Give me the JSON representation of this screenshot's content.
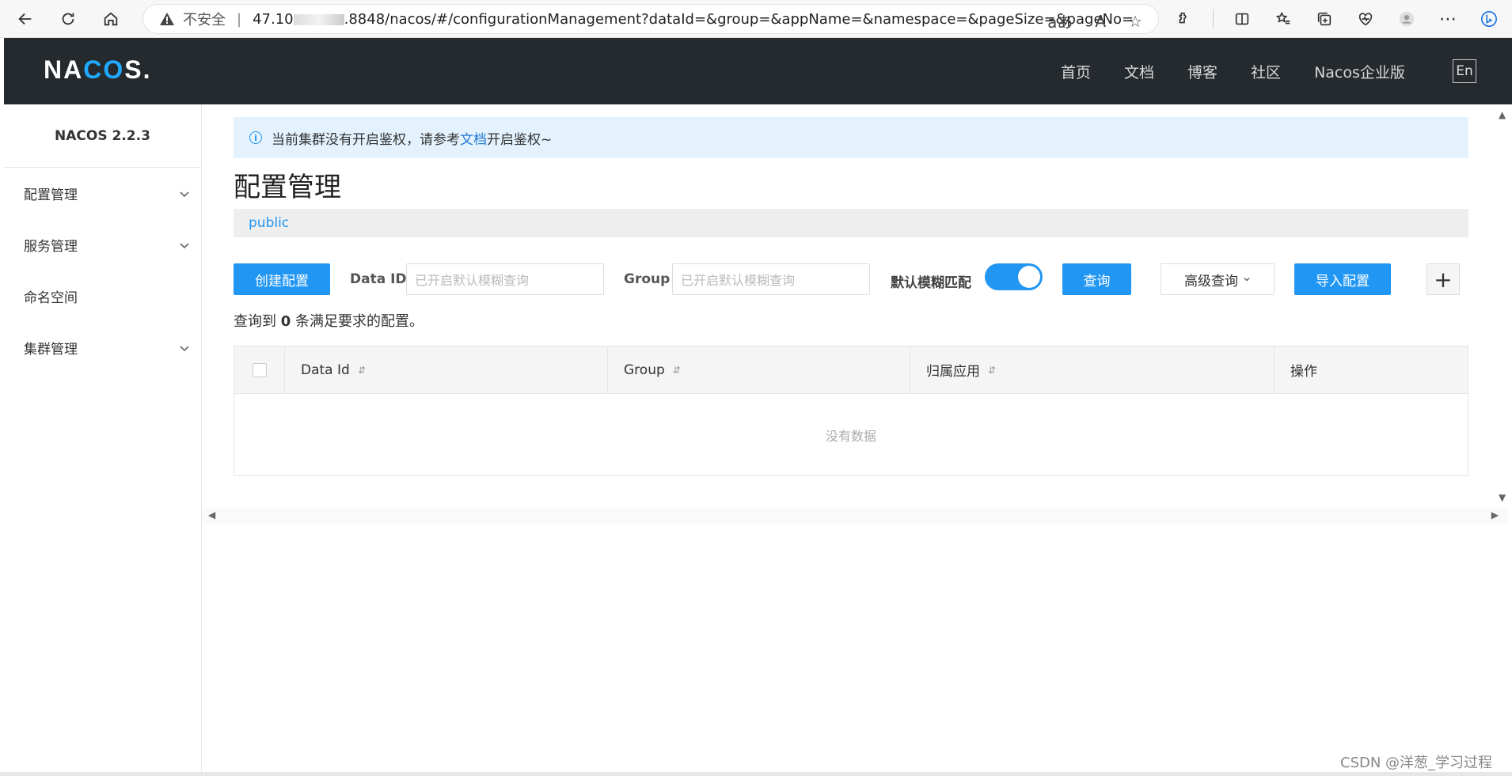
{
  "browser": {
    "insecure_label": "不安全",
    "separator": "|",
    "url_prefix": "47.10",
    "url_rest": ".8848/nacos/#/configurationManagement?dataId=&group=&appName=&namespace=&pageSize=&pageNo=",
    "read_aloud_icon": "aあ",
    "font_icon": "A"
  },
  "header": {
    "logo_text_1": "NA",
    "logo_text_o": "CO",
    "logo_text_2": "S.",
    "nav": [
      "首页",
      "文档",
      "博客",
      "社区",
      "Nacos企业版"
    ],
    "lang_button": "En"
  },
  "sidebar": {
    "version": "NACOS 2.2.3",
    "items": [
      {
        "label": "配置管理",
        "has_chevron": true
      },
      {
        "label": "服务管理",
        "has_chevron": true
      },
      {
        "label": "命名空间",
        "has_chevron": false
      },
      {
        "label": "集群管理",
        "has_chevron": true
      }
    ]
  },
  "alert": {
    "prefix": "当前集群没有开启鉴权，请参考",
    "link": "文档",
    "suffix": "开启鉴权~"
  },
  "page": {
    "title": "配置管理",
    "namespace": "public"
  },
  "toolbar": {
    "create_button": "创建配置",
    "data_id_label": "Data ID",
    "data_id_placeholder": "已开启默认模糊查询",
    "group_label": "Group",
    "group_placeholder": "已开启默认模糊查询",
    "fuzzy_label": "默认模糊匹配",
    "fuzzy_enabled": true,
    "search_button": "查询",
    "advanced_button": "高级查询",
    "import_button": "导入配置",
    "plus_button": "+"
  },
  "result": {
    "prefix": "查询到",
    "count": "0",
    "suffix": "条满足要求的配置。"
  },
  "table": {
    "columns": [
      "Data Id",
      "Group",
      "归属应用",
      "操作"
    ],
    "empty_text": "没有数据"
  },
  "watermark": "CSDN @洋葱_学习过程",
  "colors": {
    "primary": "#2196f3",
    "header_bg": "#252a2f",
    "alert_bg": "#e3f2fd"
  }
}
